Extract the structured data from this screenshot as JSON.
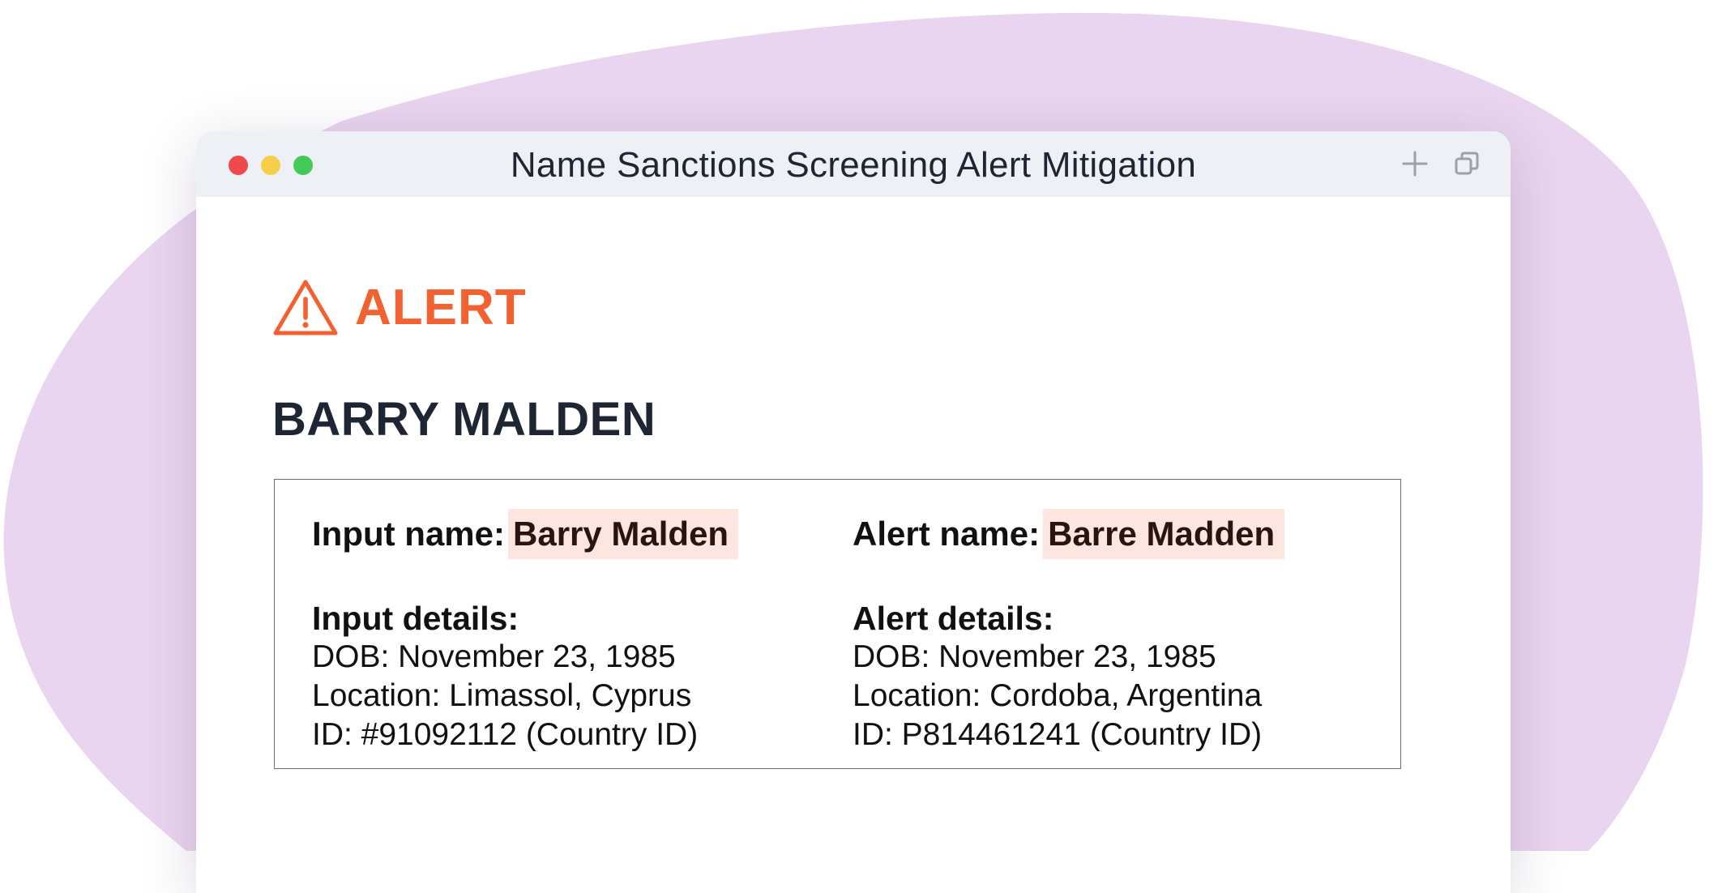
{
  "window": {
    "title": "Name Sanctions Screening Alert Mitigation",
    "controls": [
      "close",
      "minimize",
      "maximize"
    ],
    "toolbar_icons": [
      "plus-icon",
      "copy-icon"
    ]
  },
  "alert": {
    "icon": "warning-triangle-icon",
    "label": "ALERT",
    "color": "#f26130"
  },
  "subject": {
    "name": "BARRY MALDEN"
  },
  "comparison": {
    "input": {
      "name_label": "Input name:",
      "name_value": "Barry Malden",
      "details_title": "Input details:",
      "dob": "DOB: November 23, 1985",
      "location": "Location: Limassol, Cyprus",
      "id": "ID: #91092112 (Country ID)"
    },
    "alert": {
      "name_label": "Alert name:",
      "name_value": "Barre Madden",
      "details_title": "Alert details:",
      "dob": "DOB: November 23, 1985",
      "location": "Location: Cordoba, Argentina",
      "id": "ID: P814461241 (Country ID)"
    },
    "highlight_color": "#fde6df"
  },
  "colors": {
    "background_blob": "#ead5f0",
    "titlebar": "#edf1f5",
    "text_dark": "#1e2633"
  }
}
